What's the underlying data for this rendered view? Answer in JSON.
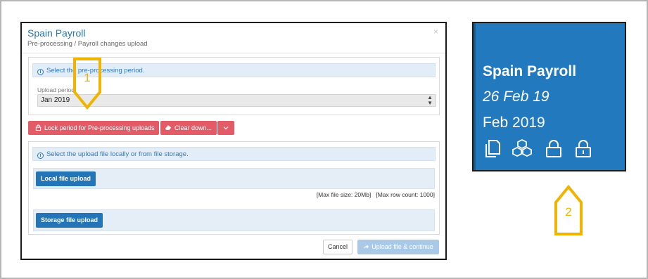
{
  "modal": {
    "title": "Spain Payroll",
    "subtitle": "Pre-processing / Payroll changes upload",
    "close_label": "×",
    "period_info": "Select the pre-processing period.",
    "upload_period_label": "Upload period",
    "upload_period_value": "Jan 2019",
    "lock_button": "Lock period for Pre-processing uploads",
    "clear_button": "Clear down...",
    "file_info": "Select the upload file locally or from file storage.",
    "local_upload_button": "Local file upload",
    "file_limits": "[Max file size: 20Mb]   [Max row count: 1000]",
    "storage_upload_button": "Storage file upload",
    "cancel_button": "Cancel",
    "continue_button": "Upload file & continue"
  },
  "callouts": {
    "one": "1",
    "two": "2"
  },
  "tile": {
    "title": "Spain Payroll",
    "date": "26 Feb 19",
    "period": "Feb 2019",
    "icons": [
      "copy-icon",
      "cubes-icon",
      "lock-icon",
      "lock-icon"
    ]
  },
  "colors": {
    "accent_blue": "#2474b8",
    "tile_blue": "#2279bd",
    "danger_red": "#e25b67",
    "callout_gold": "#f0b400"
  }
}
